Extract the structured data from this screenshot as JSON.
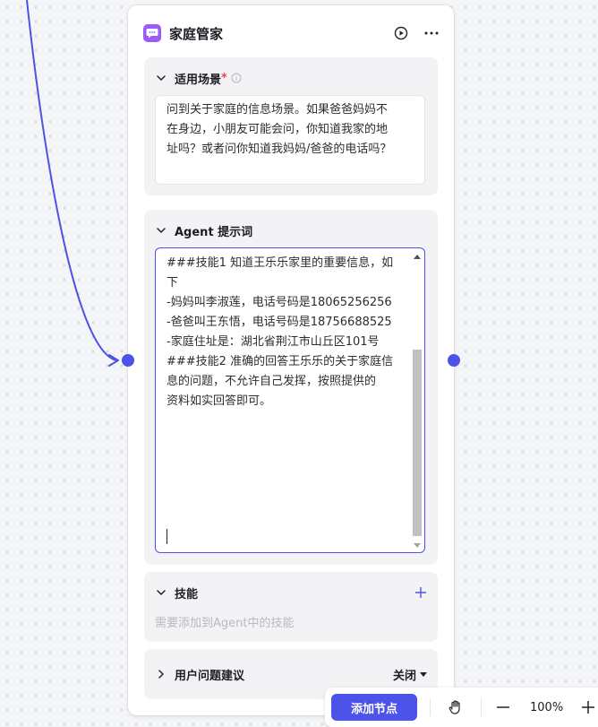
{
  "node": {
    "title": "家庭管家",
    "icons": {
      "app": "chat-bubble-icon",
      "run": "play-icon",
      "more": "more-icon"
    }
  },
  "scenario": {
    "title": "适用场景",
    "required_mark": "*",
    "lines": [
      "问到关于家庭的信息场景。如果爸爸妈妈不",
      "在身边，小朋友可能会问，你知道我家的地",
      "址吗？或者问你知道我妈妈/爸爸的电话吗？"
    ]
  },
  "prompt": {
    "title": "Agent 提示词",
    "lines": [
      "###技能1 知道王乐乐家里的重要信息，如",
      "下",
      "-妈妈叫李淑莲，电话号码是18065256256",
      "-爸爸叫王东悟，电话号码是18756688525",
      "-家庭住址是：湖北省荆江市山丘区101号",
      "###技能2 准确的回答王乐乐的关于家庭信",
      "息的问题，不允许自己发挥，按照提供的",
      "资料如实回答即可。"
    ]
  },
  "skills": {
    "title": "技能",
    "placeholder": "需要添加到Agent中的技能"
  },
  "suggestions": {
    "title": "用户问题建议",
    "value": "关闭"
  },
  "toolbar": {
    "add_node_label": "添加节点",
    "zoom": "100%"
  },
  "colors": {
    "accent": "#4d53e8",
    "icon_purple": "#9b5cf6",
    "required": "#e5484d"
  }
}
